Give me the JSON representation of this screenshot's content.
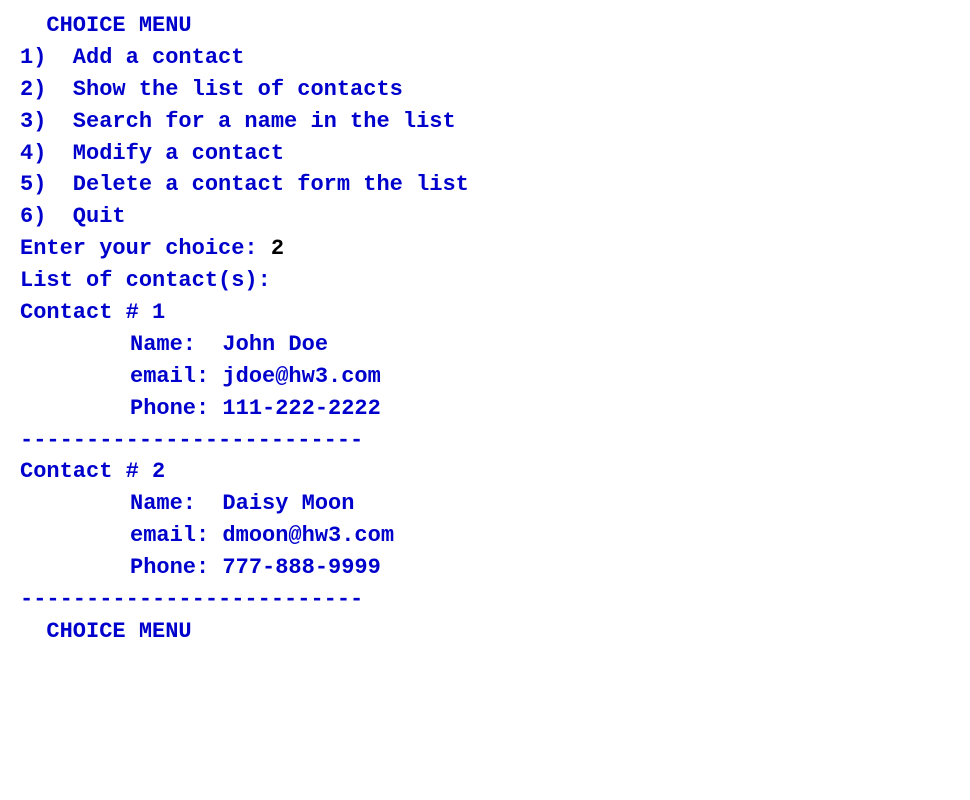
{
  "terminal": {
    "menu_title": "  CHOICE MENU",
    "menu_items": [
      "1)  Add a contact",
      "2)  Show the list of contacts",
      "3)  Search for a name in the list",
      "4)  Modify a contact",
      "5)  Delete a contact form the list",
      "6)  Quit"
    ],
    "prompt_label": "Enter your choice: ",
    "prompt_value": "2",
    "list_header": "List of contact(s):",
    "contacts": [
      {
        "header": "Contact # 1",
        "name": "Name:  John Doe",
        "email": "email: jdoe@hw3.com",
        "phone": "Phone: 111-222-2222"
      },
      {
        "header": "Contact # 2",
        "name": "Name:  Daisy Moon",
        "email": "email: dmoon@hw3.com",
        "phone": "Phone: 777-888-9999"
      }
    ],
    "separator": "--------------------------",
    "footer_title": "  CHOICE MENU"
  }
}
